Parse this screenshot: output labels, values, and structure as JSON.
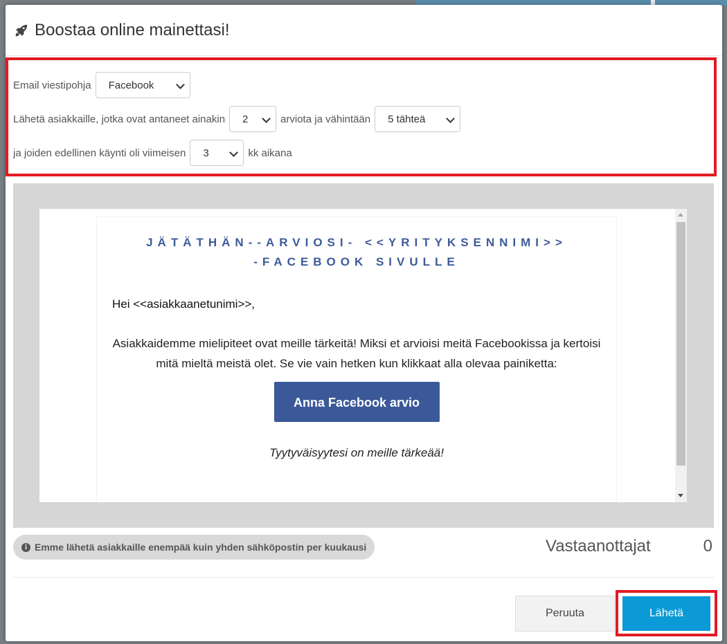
{
  "modal": {
    "title": "Boostaa online mainettasi!",
    "title_icon": "rocket-icon"
  },
  "settings": {
    "template_label": "Email viestipohja",
    "template_value": "Facebook",
    "row2_prefix": "Lähetä asiakkaille, jotka ovat antaneet ainakin",
    "reviews_value": "2",
    "row2_middle": "arviota ja vähintään",
    "stars_value": "5 tähteä",
    "row3_prefix": "ja joiden edellinen käynti oli viimeisen",
    "months_value": "3",
    "row3_suffix": "kk aikana"
  },
  "email": {
    "heading_line1": "JÄTÄTHÄN--ARVIOSI- <<YRITYKSENNIMI>>",
    "heading_line2": "-FACEBOOK SIVULLE",
    "greeting": "Hei <<asiakkaanetunimi>>,",
    "message": "Asiakkaidemme mielipiteet ovat meille tärkeitä! Miksi et arvioisi meitä Facebookissa ja kertoisi mitä mieltä meistä olet. Se vie vain hetken kun klikkaat alla olevaa painiketta:",
    "button_label": "Anna Facebook arvio",
    "closing": "Tyytyväisyytesi on meille tärkeää!",
    "heading_color": "#3d5b9a",
    "button_color": "#3b5998"
  },
  "info": {
    "icon": "info-icon",
    "text": "Emme lähetä asiakkaille enempää kuin yhden sähköpostin per kuukausi"
  },
  "recipients": {
    "label": "Vastaanottajat",
    "count": "0"
  },
  "footer": {
    "cancel_label": "Peruuta",
    "send_label": "Lähetä",
    "send_color": "#0b9ad6",
    "highlight_color": "#e21b23"
  }
}
